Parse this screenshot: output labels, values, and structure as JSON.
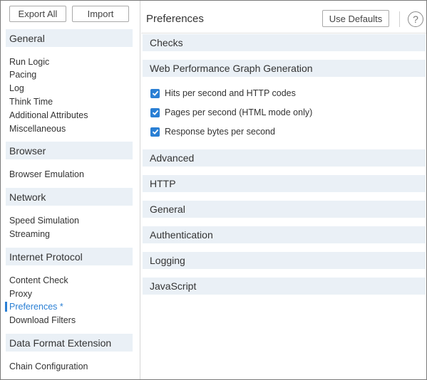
{
  "sidebar": {
    "export_label": "Export All",
    "import_label": "Import",
    "sections": [
      {
        "title": "General",
        "items": [
          "Run Logic",
          "Pacing",
          "Log",
          "Think Time",
          "Additional Attributes",
          "Miscellaneous"
        ]
      },
      {
        "title": "Browser",
        "items": [
          "Browser Emulation"
        ]
      },
      {
        "title": "Network",
        "items": [
          "Speed Simulation",
          "Streaming"
        ]
      },
      {
        "title": "Internet Protocol",
        "items": [
          "Content Check",
          "Proxy",
          "Preferences *",
          "Download Filters"
        ]
      },
      {
        "title": "Data Format Extension",
        "items": [
          "Chain Configuration"
        ]
      }
    ],
    "active_item": "Preferences *"
  },
  "main": {
    "title": "Preferences",
    "defaults_label": "Use Defaults",
    "help_glyph": "?",
    "groups": [
      {
        "title": "Checks"
      },
      {
        "title": "Web Performance Graph Generation",
        "options": [
          {
            "label": "Hits per second and HTTP codes",
            "checked": true
          },
          {
            "label": "Pages per second (HTML mode only)",
            "checked": true
          },
          {
            "label": "Response bytes per second",
            "checked": true
          }
        ]
      },
      {
        "title": "Advanced"
      },
      {
        "title": "HTTP"
      },
      {
        "title": "General"
      },
      {
        "title": "Authentication"
      },
      {
        "title": "Logging"
      },
      {
        "title": "JavaScript"
      }
    ]
  },
  "colors": {
    "accent": "#2a7fd4",
    "section_bg": "#eaf0f6"
  }
}
